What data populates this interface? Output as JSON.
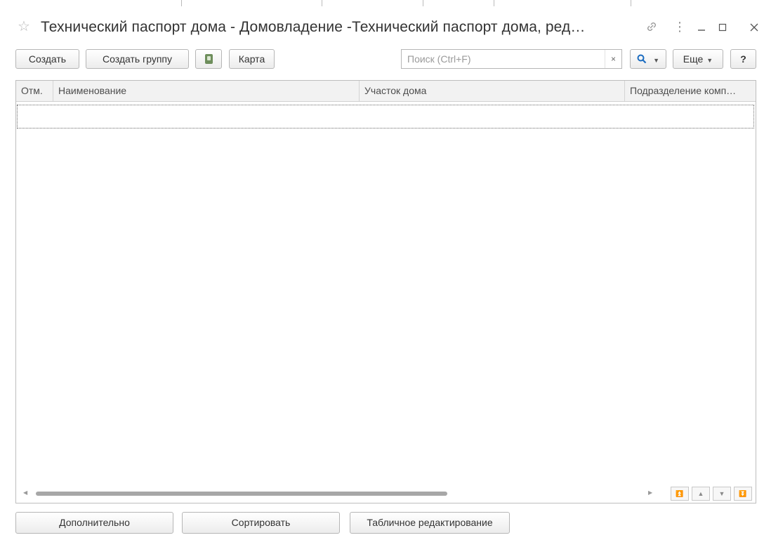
{
  "window": {
    "title": "Технический паспорт дома -   Домовладение -Технический паспорт дома, ред…",
    "star_icon": "star-icon",
    "link_icon": "link-icon",
    "menu_icon": "more-vertical-icon",
    "minimize_icon": "minimize-icon",
    "maximize_icon": "maximize-icon",
    "close_icon": "close-icon"
  },
  "toolbar": {
    "create_label": "Создать",
    "create_group_label": "Создать группу",
    "print_icon": "document-icon",
    "map_label": "Карта",
    "search_placeholder": "Поиск (Ctrl+F)",
    "search_value": "",
    "clear_label": "×",
    "search_button_icon": "search-icon",
    "more_label": "Еще",
    "help_label": "?"
  },
  "table": {
    "columns": [
      "Отм.",
      "Наименование",
      "Участок дома",
      "Подразделение комп…"
    ],
    "rows": []
  },
  "navigation": {
    "first_icon": "first-page-icon",
    "up_icon": "up-icon",
    "down_icon": "down-icon",
    "last_icon": "last-page-icon"
  },
  "footer": {
    "additional_label": "Дополнительно",
    "sort_label": "Сортировать",
    "table_edit_label": "Табличное редактирование"
  },
  "colors": {
    "accent": "#1b6cc0",
    "border": "#b6b6b6",
    "header_bg": "#f2f2f2"
  }
}
